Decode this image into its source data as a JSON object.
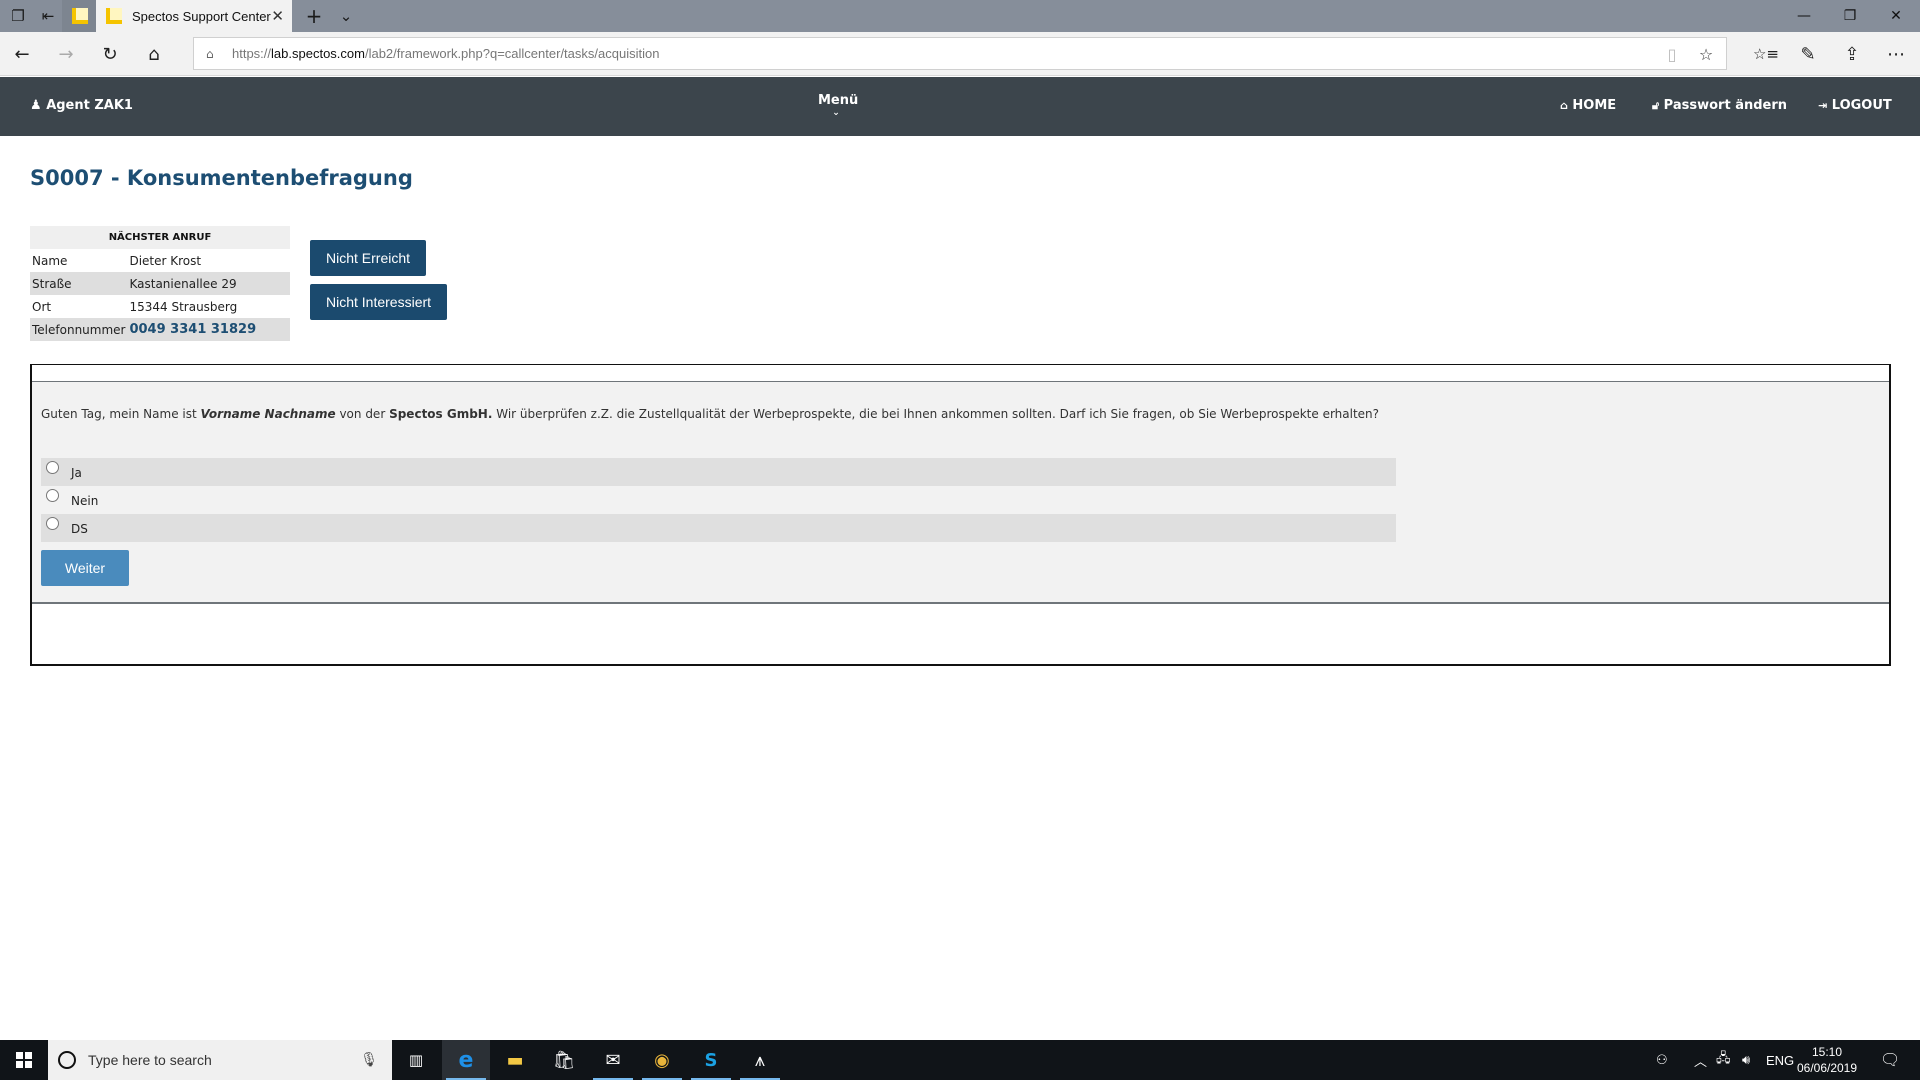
{
  "browser": {
    "tab_title": "Spectos Support Center",
    "url_prefix": "https://",
    "url_domain": "lab.spectos.com",
    "url_path": "/lab2/framework.php?q=callcenter/tasks/acquisition",
    "icons": {
      "tab_manager": "tab-manager-icon",
      "set_aside": "set-aside-tabs-icon",
      "new_tab": "+",
      "tab_list": "⌄",
      "back": "←",
      "forward": "→",
      "refresh": "↻",
      "home": "⌂",
      "lock": "🔒",
      "reading_view": "📖",
      "favorite": "☆",
      "favorites_hub": "☆≡",
      "notes": "✎",
      "share": "⇪",
      "more": "⋯",
      "minimize": "—",
      "restore": "❐",
      "close": "✕"
    }
  },
  "nav": {
    "agent_label": "Agent ZAK1",
    "menu_label": "Menü",
    "home_label": "HOME",
    "password_label": "Passwort ändern",
    "logout_label": "LOGOUT"
  },
  "page": {
    "title": "S0007 - Konsumentenbefragung"
  },
  "next_call": {
    "header": "NÄCHSTER ANRUF",
    "rows": [
      {
        "label": "Name",
        "value": "Dieter Krost"
      },
      {
        "label": "Straße",
        "value": "Kastanienallee 29"
      },
      {
        "label": "Ort",
        "value": "15344 Strausberg"
      },
      {
        "label": "Telefonnummer",
        "value": "0049 3341 31829"
      }
    ]
  },
  "actions": {
    "not_reached": "Nicht Erreicht",
    "not_interested": "Nicht Interessiert"
  },
  "survey": {
    "question_parts": {
      "p1": "Guten Tag, mein Name ist ",
      "name_placeholder": "Vorname Nachname",
      "p2": " von der ",
      "company": "Spectos GmbH.",
      "p3": " Wir überprüfen z.Z. die Zustellqualität der Werbeprospekte, die bei Ihnen ankommen sollten. Darf ich Sie fragen, ob Sie Werbeprospekte erhalten?"
    },
    "options": [
      "Ja",
      "Nein",
      "DS"
    ],
    "selected": null,
    "next_label": "Weiter"
  },
  "taskbar": {
    "search_placeholder": "Type here to search",
    "language": "ENG",
    "time": "15:10",
    "date": "06/06/2019"
  }
}
